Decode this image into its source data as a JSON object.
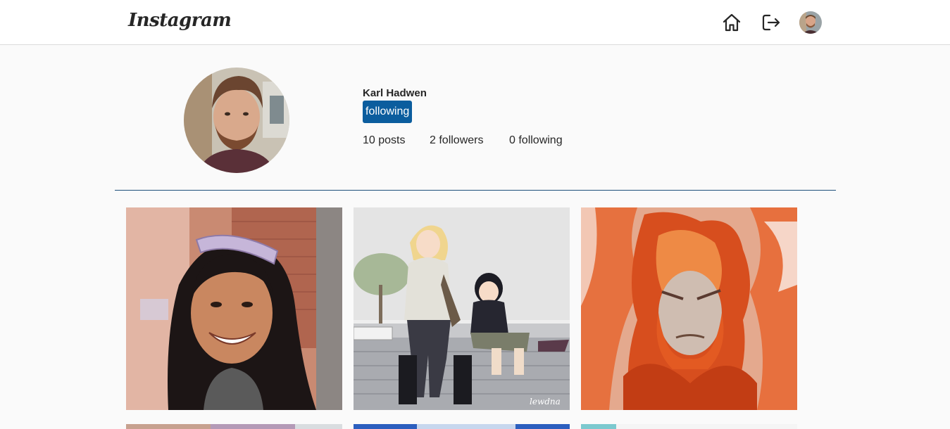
{
  "header": {
    "logo_text": "Instagram",
    "icons": [
      "home-icon",
      "logout-icon",
      "user-avatar"
    ]
  },
  "profile": {
    "name": "Karl Hadwen",
    "follow_button_label": "following",
    "posts_count": "10 posts",
    "followers_count": "2 followers",
    "following_count": "0 following"
  },
  "colors": {
    "accent": "#0b5d9e",
    "divider": "#1e4f7a",
    "background": "#fafafa"
  },
  "posts": [
    {
      "subject": "photo of smiling woman with sunglasses"
    },
    {
      "subject": "illustration of two anime girls on steps"
    },
    {
      "subject": "illustration of fiery anime character"
    },
    {
      "subject": "photo"
    },
    {
      "subject": "photo"
    },
    {
      "subject": "photo"
    }
  ]
}
